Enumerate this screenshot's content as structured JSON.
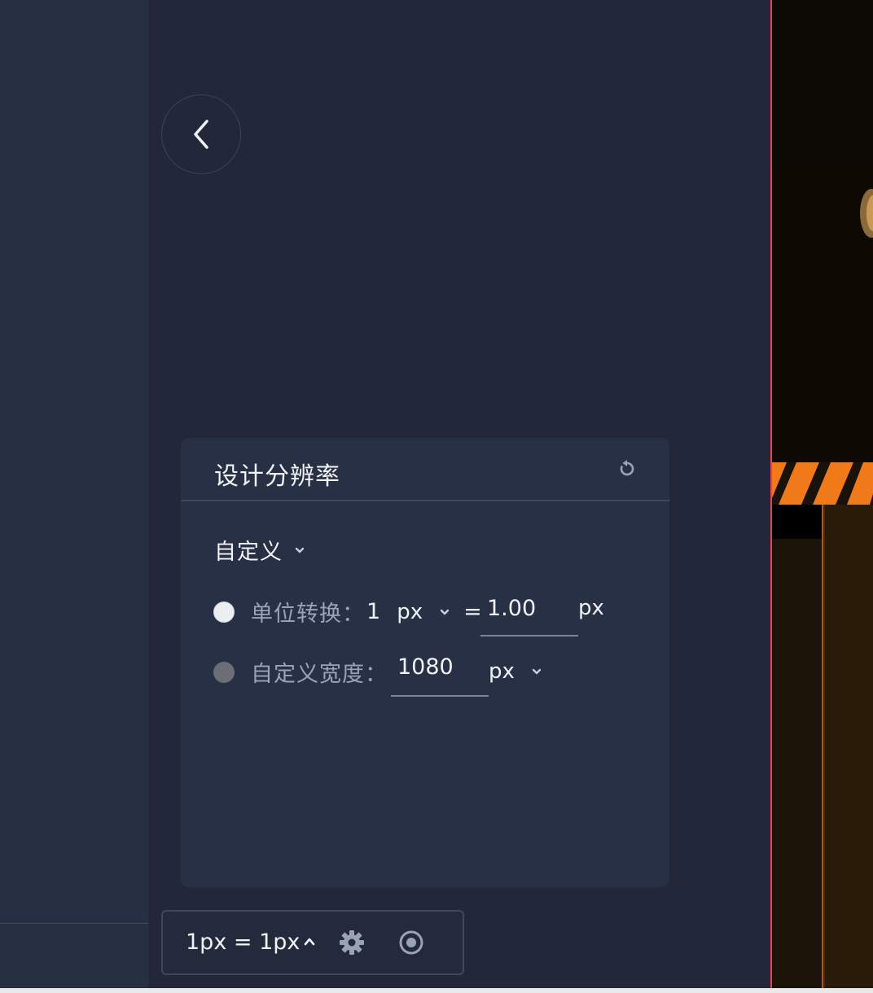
{
  "panel": {
    "title": "设计分辨率",
    "reset_icon": "reset-icon",
    "preset_label": "自定义",
    "unit_conversion": {
      "label": "单位转换：",
      "source_value": "1",
      "source_unit": "px",
      "equals": "=",
      "target_value": "1.00",
      "target_unit": "px",
      "selected": true
    },
    "custom_width": {
      "label": "自定义宽度：",
      "value": "1080",
      "unit": "px",
      "selected": false
    }
  },
  "toolbar": {
    "scale_label": "1px = 1px",
    "icons": [
      "chevron-up-icon",
      "gear-icon",
      "eye-icon"
    ]
  },
  "colors": {
    "background": "#222839",
    "panel": "#273044",
    "sidebar": "#273042",
    "canvas_border": "#e04455",
    "hazard_orange": "#f07a1a"
  }
}
